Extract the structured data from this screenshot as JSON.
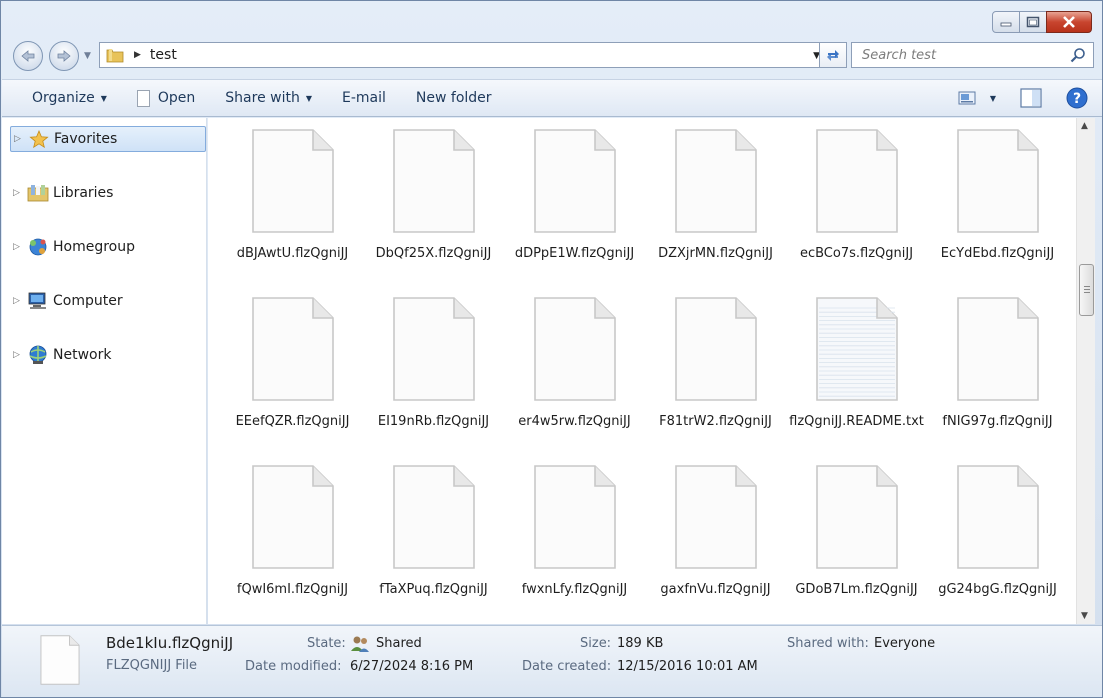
{
  "window": {
    "caption_buttons": [
      "minimize",
      "maximize",
      "close"
    ]
  },
  "address": {
    "path": [
      "test"
    ],
    "search_placeholder": "Search test"
  },
  "toolbar": {
    "organize": "Organize",
    "open": "Open",
    "share_with": "Share with",
    "email": "E-mail",
    "new_folder": "New folder"
  },
  "nav": {
    "items": [
      {
        "label": "Favorites",
        "icon": "star-icon"
      },
      {
        "label": "Libraries",
        "icon": "libraries-icon"
      },
      {
        "label": "Homegroup",
        "icon": "homegroup-icon"
      },
      {
        "label": "Computer",
        "icon": "computer-icon"
      },
      {
        "label": "Network",
        "icon": "network-icon"
      }
    ]
  },
  "files": [
    {
      "name": "dBJAwtU.flzQgniJJ",
      "kind": "blank"
    },
    {
      "name": "DbQf25X.flzQgniJJ",
      "kind": "blank"
    },
    {
      "name": "dDPpE1W.flzQgniJJ",
      "kind": "blank"
    },
    {
      "name": "DZXjrMN.flzQgniJJ",
      "kind": "blank"
    },
    {
      "name": "ecBCo7s.flzQgniJJ",
      "kind": "blank"
    },
    {
      "name": "EcYdEbd.flzQgniJJ",
      "kind": "blank"
    },
    {
      "name": "EEefQZR.flzQgniJJ",
      "kind": "blank"
    },
    {
      "name": "EI19nRb.flzQgniJJ",
      "kind": "blank"
    },
    {
      "name": "er4w5rw.flzQgniJJ",
      "kind": "blank"
    },
    {
      "name": "F81trW2.flzQgniJJ",
      "kind": "blank"
    },
    {
      "name": "flzQgniJJ.README.txt",
      "kind": "text"
    },
    {
      "name": "fNIG97g.flzQgniJJ",
      "kind": "blank"
    },
    {
      "name": "fQwI6mI.flzQgniJJ",
      "kind": "blank"
    },
    {
      "name": "fTaXPuq.flzQgniJJ",
      "kind": "blank"
    },
    {
      "name": "fwxnLfy.flzQgniJJ",
      "kind": "blank"
    },
    {
      "name": "gaxfnVu.flzQgniJJ",
      "kind": "blank"
    },
    {
      "name": "GDoB7Lm.flzQgniJJ",
      "kind": "blank"
    },
    {
      "name": "gG24bgG.flzQgniJJ",
      "kind": "blank"
    }
  ],
  "details": {
    "name": "Bde1kIu.flzQgniJJ",
    "type": "FLZQGNIJJ File",
    "state_label": "State:",
    "state_value": "Shared",
    "size_label": "Size:",
    "size_value": "189 KB",
    "shared_with_label": "Shared with:",
    "shared_with_value": "Everyone",
    "modified_label": "Date modified:",
    "modified_value": "6/27/2024 8:16 PM",
    "created_label": "Date created:",
    "created_value": "12/15/2016 10:01 AM"
  },
  "colors": {
    "accent": "#1e395b",
    "selection": "#cfe2f7",
    "close": "#c8452f"
  }
}
